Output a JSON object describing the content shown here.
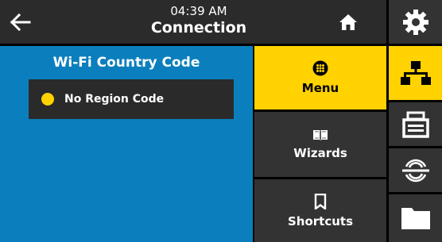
{
  "header": {
    "time": "04:39 AM",
    "title": "Connection",
    "back_icon": "arrow-left-icon",
    "home_icon": "home-icon"
  },
  "content": {
    "title": "Wi-Fi Country Code",
    "options": [
      {
        "label": "No Region Code",
        "selected": true
      }
    ]
  },
  "menu": {
    "items": [
      {
        "label": "Menu",
        "icon": "menu-grid-icon",
        "active": true
      },
      {
        "label": "Wizards",
        "icon": "book-icon",
        "active": false
      },
      {
        "label": "Shortcuts",
        "icon": "bookmark-icon",
        "active": false
      }
    ]
  },
  "tabs": [
    {
      "name": "settings",
      "icon": "gear-icon",
      "active": false
    },
    {
      "name": "connection",
      "icon": "network-icon",
      "active": true
    },
    {
      "name": "print",
      "icon": "printer-icon",
      "active": false
    },
    {
      "name": "rfid",
      "icon": "rfid-icon",
      "active": false
    },
    {
      "name": "storage",
      "icon": "folder-icon",
      "active": false
    }
  ],
  "colors": {
    "accent": "#ffd200",
    "content_bg": "#0b7fbd",
    "panel_bg": "#333333",
    "option_bg": "#2a2a2a"
  }
}
